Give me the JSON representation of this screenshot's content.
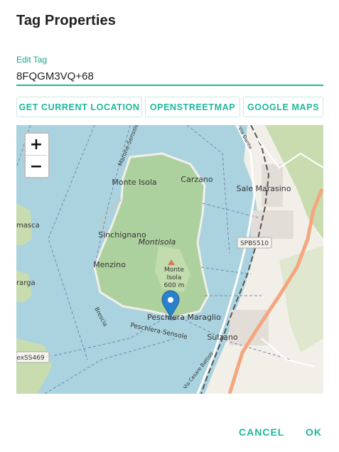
{
  "dialog": {
    "title": "Tag Properties"
  },
  "tag_field": {
    "label": "Edit Tag",
    "value": "8FQGM3VQ+68"
  },
  "buttons": {
    "current_location": "GET CURRENT LOCATION",
    "openstreetmap": "OPENSTREETMAP",
    "google_maps": "GOOGLE MAPS"
  },
  "map": {
    "zoom_in": "+",
    "zoom_out": "−",
    "labels": {
      "monte_isola": "Monte Isola",
      "carzano": "Carzano",
      "sale_marasino": "Sale Marasino",
      "mmasca": "masca",
      "sinchignano": "Sinchignano",
      "montisola": "Montisola",
      "sp510": "SPBS510",
      "menzino": "Menzino",
      "monte_isola_peak1": "Monte",
      "monte_isola_peak2": "Isola",
      "monte_isola_peak3": "600 m",
      "marga": "rarga",
      "peschiera": "Peschiera Maraglio",
      "sulzano": "Sulzano",
      "sp469": "exSS469",
      "ferry_marone": "Marone-Sensole",
      "ferry_peschiera": "Peschiera-Sensole",
      "ferry_brescia": "Brescia",
      "via_dante": "Via Dante",
      "via_cesare": "Via Cesare Battisti"
    }
  },
  "footer": {
    "cancel": "CANCEL",
    "ok": "OK"
  },
  "colors": {
    "accent": "#1fb89a",
    "water": "#aad3df",
    "land": "#f2efe9",
    "forest": "#add19e",
    "road": "#f4a77f"
  }
}
